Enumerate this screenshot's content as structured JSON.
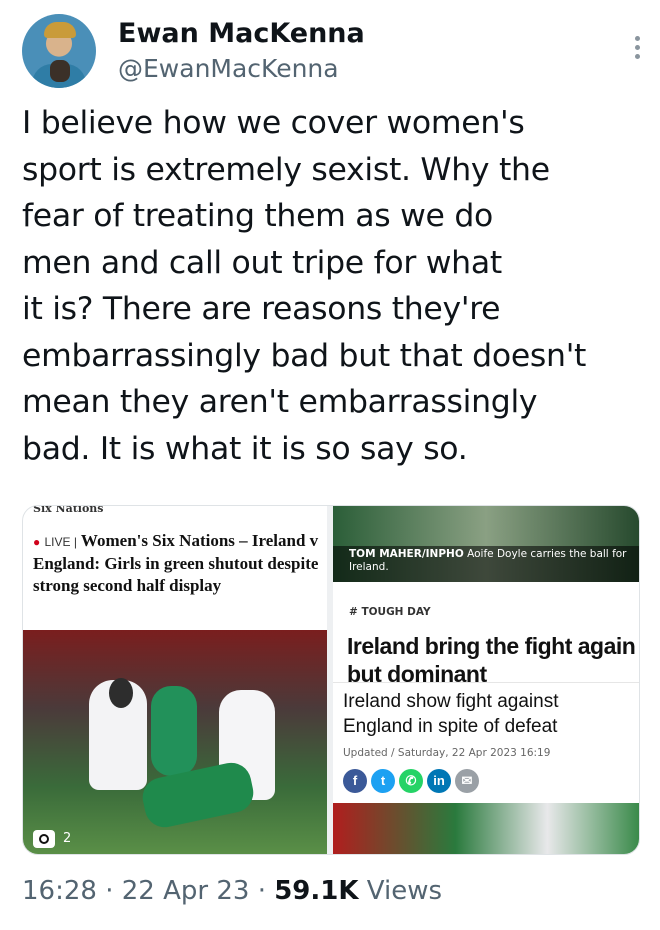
{
  "author": {
    "display_name": "Ewan MacKenna",
    "handle": "@EwanMacKenna"
  },
  "tweet": {
    "text": "I believe how we cover women's\nsport is extremely sexist. Why the\nfear of treating them as we do\nmen and call out tripe for what\nit is?  There are reasons they're\nembarrassingly bad but that doesn't\nmean they aren't embarrassingly\nbad. It is what it is so say so."
  },
  "media": {
    "left": {
      "section": "Six Nations",
      "live_label": "LIVE |",
      "headline": "Women's Six Nations – Ireland v England: Girls in green shutout despite strong second half display",
      "photo_count": "2"
    },
    "right": {
      "caption_credit": "TOM MAHER/INPHO",
      "caption_text": "Aoife Doyle carries the ball for Ireland.",
      "tag": "# TOUGH DAY",
      "headline": "Ireland bring the fight again but dominant",
      "sub_title": "Ireland show fight against England in spite of defeat",
      "updated": "Updated / Saturday, 22 Apr 2023 16:19"
    }
  },
  "footer": {
    "time": "16:28",
    "date": "22 Apr 23",
    "views_count": "59.1K",
    "views_label": "Views"
  },
  "colors": {
    "facebook": "#3b5998",
    "twitter": "#1da1f2",
    "whatsapp": "#25d366",
    "linkedin": "#0077b5",
    "email": "#9aa0a6"
  }
}
